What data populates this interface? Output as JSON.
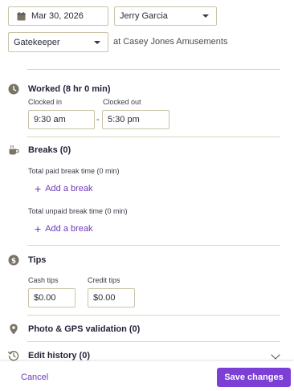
{
  "header": {
    "date_value": "Mar 30, 2026",
    "employee_value": "Jerry Garcia",
    "role_value": "Gatekeeper",
    "location_text": "at Casey Jones Amusements"
  },
  "worked": {
    "title": "Worked (8 hr 0 min)",
    "clock_in_label": "Clocked in",
    "clock_out_label": "Clocked out",
    "clock_in_value": "9:30 am",
    "clock_out_value": "5:30 pm",
    "separator": "-"
  },
  "breaks": {
    "title": "Breaks (0)",
    "paid_label": "Total paid break time (0 min)",
    "unpaid_label": "Total unpaid break time (0 min)",
    "add_label": "Add a break"
  },
  "tips": {
    "title": "Tips",
    "cash_label": "Cash tips",
    "credit_label": "Credit tips",
    "cash_value": "$0.00",
    "credit_value": "$0.00"
  },
  "photo": {
    "title": "Photo & GPS validation (0)"
  },
  "history": {
    "title": "Edit history (0)"
  },
  "footer": {
    "cancel_label": "Cancel",
    "save_label": "Save changes"
  },
  "colors": {
    "accent": "#7b3fd6",
    "link": "#6a3ab6",
    "icon": "#7a7466"
  },
  "icons": [
    "calendar-icon",
    "clock-icon",
    "coffee-icon",
    "dollar-icon",
    "location-pin-icon",
    "history-icon",
    "chevron-down-icon",
    "plus-icon"
  ]
}
